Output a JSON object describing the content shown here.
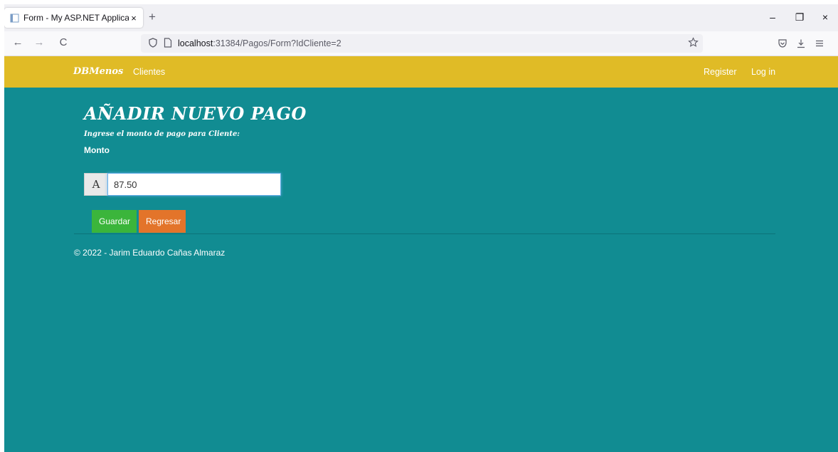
{
  "browser": {
    "tab_title": "Form - My ASP.NET Application",
    "tab_close": "×",
    "new_tab": "+",
    "window_controls": {
      "minimize": "–",
      "restore": "❐",
      "close": "×"
    },
    "nav": {
      "back": "←",
      "forward": "→",
      "reload": "C"
    },
    "url_host": "localhost",
    "url_rest": ":31384/Pagos/Form?IdCliente=2"
  },
  "site": {
    "brand": "DBMenos",
    "nav_left": [
      "Clientes"
    ],
    "nav_right": [
      "Register",
      "Log in"
    ],
    "colors": {
      "navbar": "#e0bb26",
      "background": "#118c92",
      "save": "#3bb53b",
      "back": "#e3742a"
    }
  },
  "form": {
    "title": "AÑADIR NUEVO PAGO",
    "subtitle": "Ingrese el monto de pago para Cliente:",
    "amount_label": "Monto",
    "addon_text": "A",
    "amount_value": "87.50",
    "save_label": "Guardar",
    "back_label": "Regresar"
  },
  "footer": {
    "text": "© 2022 - Jarim Eduardo Cañas Almaraz"
  }
}
